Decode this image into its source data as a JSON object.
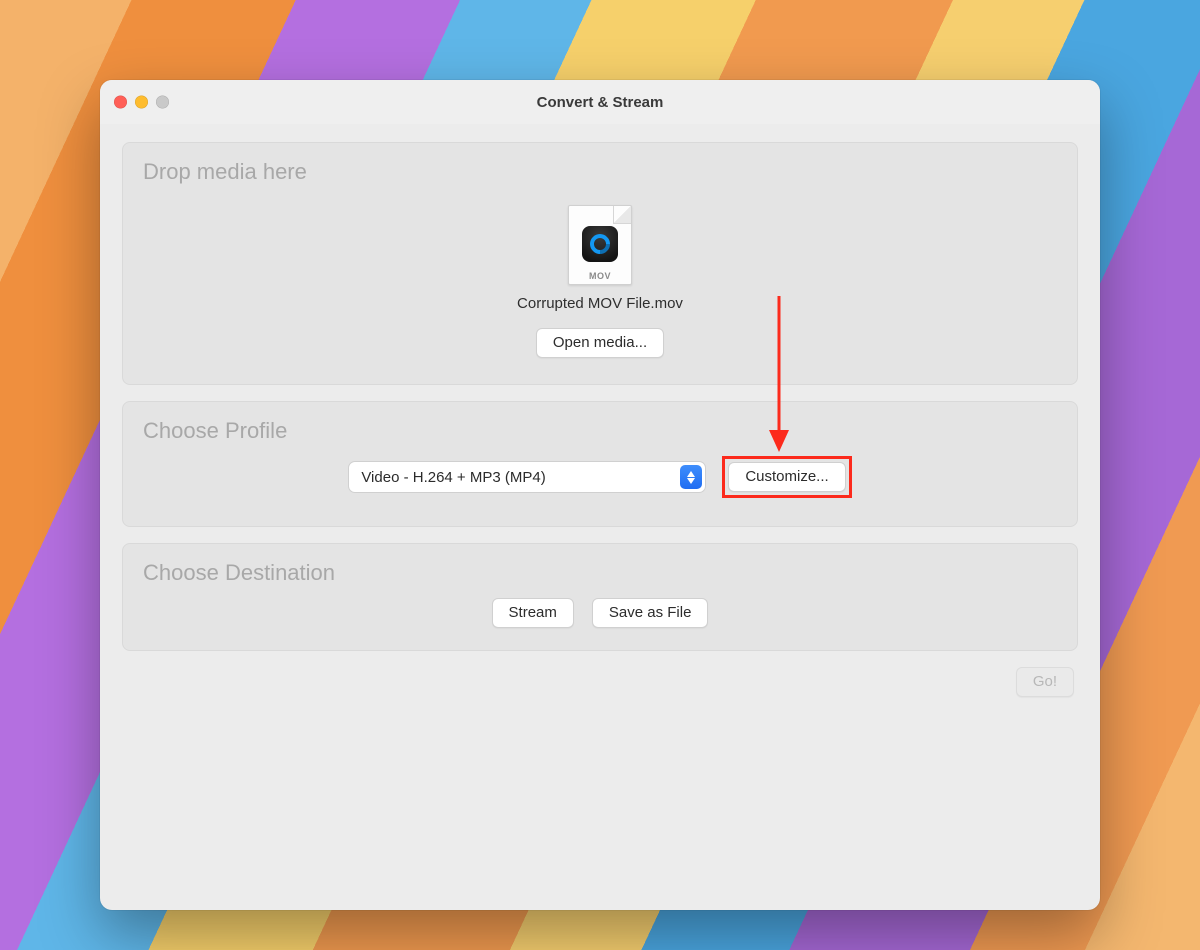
{
  "window": {
    "title": "Convert & Stream"
  },
  "drop": {
    "section_title": "Drop media here",
    "file_ext": "MOV",
    "file_name": "Corrupted MOV File.mov",
    "open_button": "Open media..."
  },
  "profile": {
    "section_title": "Choose Profile",
    "selected": "Video - H.264 + MP3 (MP4)",
    "customize_button": "Customize..."
  },
  "destination": {
    "section_title": "Choose Destination",
    "stream_button": "Stream",
    "save_button": "Save as File"
  },
  "footer": {
    "go_button": "Go!"
  }
}
